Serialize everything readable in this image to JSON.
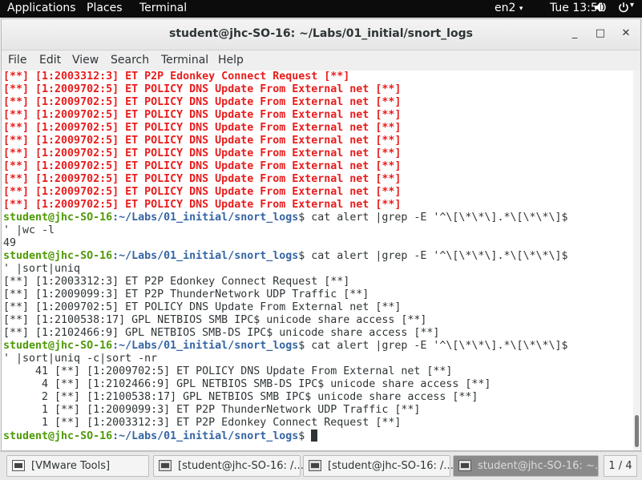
{
  "topbar": {
    "applications": "Applications",
    "places": "Places",
    "terminal": "Terminal",
    "keyboard": "en2",
    "clock": "Tue 13:51",
    "arrow": "▾",
    "volume_icon": "speaker-icon",
    "power_icon": "power-icon"
  },
  "window": {
    "title": "student@jhc-SO-16: ~/Labs/01_initial/snort_logs",
    "minimize": "_",
    "maximize": "□",
    "close": "✕"
  },
  "menubar": {
    "file": "File",
    "edit": "Edit",
    "view": "View",
    "search": "Search",
    "terminal": "Terminal",
    "help": "Help"
  },
  "terminal": {
    "prompt_user": "student@jhc-SO-16",
    "prompt_path": ":~/Labs/01_initial/snort_logs",
    "prompt_suffix": "$ ",
    "red_lines": [
      "[**] [1:2003312:3] ET P2P Edonkey Connect Request [**]",
      "[**] [1:2009702:5] ET POLICY DNS Update From External net [**]",
      "[**] [1:2009702:5] ET POLICY DNS Update From External net [**]",
      "[**] [1:2009702:5] ET POLICY DNS Update From External net [**]",
      "[**] [1:2009702:5] ET POLICY DNS Update From External net [**]",
      "[**] [1:2009702:5] ET POLICY DNS Update From External net [**]",
      "[**] [1:2009702:5] ET POLICY DNS Update From External net [**]",
      "[**] [1:2009702:5] ET POLICY DNS Update From External net [**]",
      "[**] [1:2009702:5] ET POLICY DNS Update From External net [**]",
      "[**] [1:2009702:5] ET POLICY DNS Update From External net [**]",
      "[**] [1:2009702:5] ET POLICY DNS Update From External net [**]"
    ],
    "cmd1": "cat alert |grep -E '^\\[\\*\\*\\].*\\[\\*\\*\\]$",
    "cmd1_cont": "' |wc -l",
    "out1": "49",
    "cmd2": "cat alert |grep -E '^\\[\\*\\*\\].*\\[\\*\\*\\]$",
    "cmd2_cont": "' |sort|uniq",
    "out2": [
      "[**] [1:2003312:3] ET P2P Edonkey Connect Request [**]",
      "[**] [1:2009099:3] ET P2P ThunderNetwork UDP Traffic [**]",
      "[**] [1:2009702:5] ET POLICY DNS Update From External net [**]",
      "[**] [1:2100538:17] GPL NETBIOS SMB IPC$ unicode share access [**]",
      "[**] [1:2102466:9] GPL NETBIOS SMB-DS IPC$ unicode share access [**]"
    ],
    "cmd3": "cat alert |grep -E '^\\[\\*\\*\\].*\\[\\*\\*\\]$",
    "cmd3_cont": "' |sort|uniq -c|sort -nr",
    "out3": [
      "     41 [**] [1:2009702:5] ET POLICY DNS Update From External net [**]",
      "      4 [**] [1:2102466:9] GPL NETBIOS SMB-DS IPC$ unicode share access [**]",
      "      2 [**] [1:2100538:17] GPL NETBIOS SMB IPC$ unicode share access [**]",
      "      1 [**] [1:2009099:3] ET P2P ThunderNetwork UDP Traffic [**]",
      "      1 [**] [1:2003312:3] ET P2P Edonkey Connect Request [**]"
    ]
  },
  "taskbar": {
    "tasks": [
      {
        "label": "[VMware Tools]",
        "icon": "window-icon"
      },
      {
        "label": "[student@jhc-SO-16: /...",
        "icon": "terminal-icon"
      },
      {
        "label": "[student@jhc-SO-16: /...",
        "icon": "terminal-icon"
      },
      {
        "label": "student@jhc-SO-16: ~...",
        "icon": "terminal-icon"
      }
    ],
    "workspace": "1 / 4"
  }
}
